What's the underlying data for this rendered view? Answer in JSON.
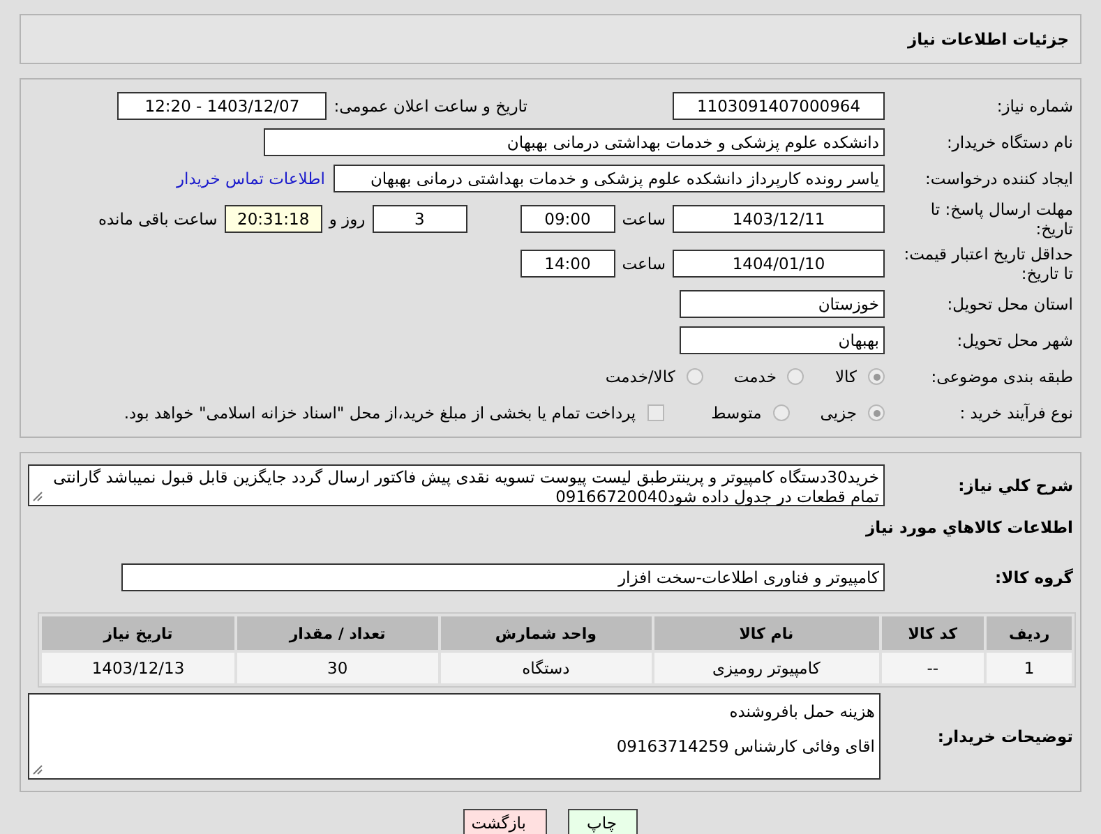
{
  "header": {
    "title": "جزئیات اطلاعات نیاز"
  },
  "need_number": {
    "label": "شماره نیاز:",
    "value": "1103091407000964"
  },
  "announce": {
    "label": "تاریخ و ساعت اعلان عمومی:",
    "value": "1403/12/07 - 12:20"
  },
  "buyer_org": {
    "label": "نام دستگاه خریدار:",
    "value": "دانشکده علوم پزشکی و خدمات بهداشتی  درمانی بهبهان"
  },
  "requester": {
    "label": "ایجاد کننده درخواست:",
    "value": "یاسر رونده کارپرداز دانشکده علوم پزشکی و خدمات بهداشتی  درمانی بهبهان",
    "link": "اطلاعات تماس خریدار"
  },
  "response_deadline": {
    "label": "مهلت ارسال پاسخ: تا تاریخ:",
    "date": "1403/12/11",
    "time_label": "ساعت",
    "time": "09:00",
    "days": "3",
    "days_label": "روز و",
    "remaining": "20:31:18",
    "remaining_label": "ساعت باقی مانده"
  },
  "price_validity": {
    "label": "حداقل تاریخ اعتبار قیمت: تا تاریخ:",
    "date": "1404/01/10",
    "time_label": "ساعت",
    "time": "14:00"
  },
  "province": {
    "label": "استان محل تحویل:",
    "value": "خوزستان"
  },
  "city": {
    "label": "شهر محل تحویل:",
    "value": "بهبهان"
  },
  "category": {
    "label": "طبقه بندی موضوعی:",
    "options": [
      {
        "label": "کالا",
        "selected": true
      },
      {
        "label": "خدمت",
        "selected": false
      },
      {
        "label": "کالا/خدمت",
        "selected": false
      }
    ]
  },
  "process": {
    "label": "نوع فرآیند خرید :",
    "options": [
      {
        "label": "جزیی",
        "selected": true
      },
      {
        "label": "متوسط",
        "selected": false
      }
    ],
    "payment": {
      "checked": false,
      "text": "پرداخت تمام یا بخشی از مبلغ خرید،از محل \"اسناد خزانه اسلامی\" خواهد بود."
    }
  },
  "description": {
    "label": "شرح کلي نياز:",
    "value": "خرید30دستگاه کامپیوتر و پرینترطبق لیست پیوست تسویه نقدی پیش فاکتور ارسال گردد جایگزین قابل قبول نمیباشد گارانتی تمام قطعات در جدول داده شود09166720040"
  },
  "goods_section": {
    "title": "اطلاعات کالاهاي مورد نياز"
  },
  "goods_group": {
    "label": "گروه کالا:",
    "value": "کامپیوتر و فناوری اطلاعات-سخت افزار"
  },
  "table": {
    "columns": [
      "ردیف",
      "کد کالا",
      "نام کالا",
      "واحد شمارش",
      "تعداد / مقدار",
      "تاریخ نیاز"
    ],
    "rows": [
      [
        "1",
        "--",
        "کامپیوتر رومیزی",
        "دستگاه",
        "30",
        "1403/12/13"
      ]
    ]
  },
  "buyer_notes": {
    "label": "توضیحات خریدار:",
    "lines": [
      "هزینه حمل بافروشنده",
      "اقای وفائی کارشناس 09163714259"
    ]
  },
  "buttons": [
    {
      "label": "چاپ",
      "kind": "print"
    },
    {
      "label": "بازگشت",
      "kind": "back"
    }
  ]
}
